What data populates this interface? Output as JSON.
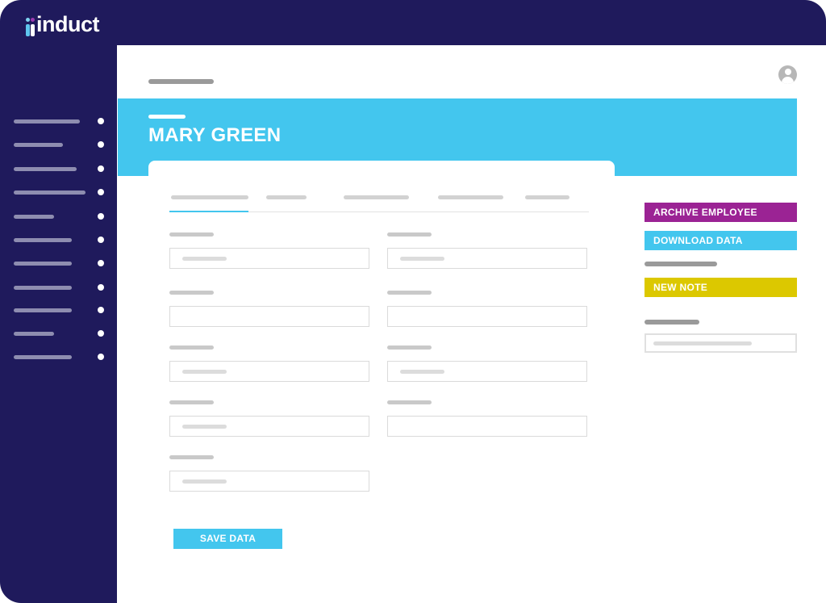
{
  "app": {
    "logo_text": "induct"
  },
  "sidebar": {
    "item_count": 11
  },
  "header": {
    "user_avatar_icon": "user-avatar-icon"
  },
  "employee": {
    "name": "MARY GREEN"
  },
  "actions": {
    "archive_label": "ARCHIVE EMPLOYEE",
    "download_label": "DOWNLOAD DATA",
    "note_label": "NEW NOTE"
  },
  "form": {
    "save_label": "SAVE DATA"
  },
  "colors": {
    "navy": "#1f1a5c",
    "cyan": "#43c6ee",
    "purple": "#9b2394",
    "yellow": "#dcc800"
  }
}
